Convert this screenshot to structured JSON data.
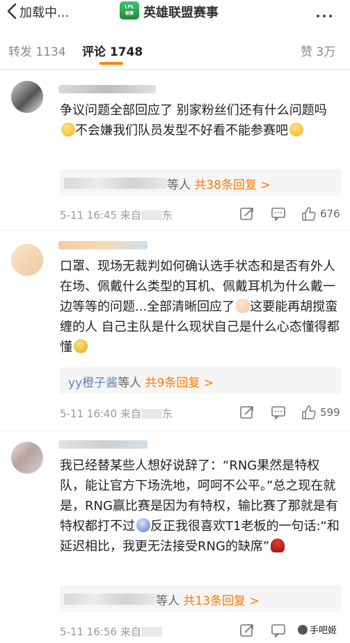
{
  "header": {
    "back_label": "加载中...",
    "logo_text": "LPL",
    "title": "英雄联盟赛事"
  },
  "tabs": [
    {
      "label": "转发 1134"
    },
    {
      "label": "评论 1748"
    },
    {
      "label": "赞 3万"
    }
  ],
  "comments": [
    {
      "text": "争议问题全部回应了 别家粉丝们还有什么问题吗",
      "text_tail": "不会嫌我们队员发型不好看不能参赛吧",
      "reply_suffix": "等人",
      "reply_count": "共38条回复 >",
      "time": "5-11 16:45",
      "source": "来自",
      "source_tail": "东",
      "likes": "676"
    },
    {
      "text": "口罩、现场无裁判如何确认选手状态和是否有外人在场、佩戴什么类型的耳机、佩戴耳机为什么戴一边等等的问题...全部清晰回应了",
      "text_tail": "这要能再胡搅蛮缠的人 自己主队是什么现状自己是什么心态懂得都懂",
      "reply_user": "yy橙子酱",
      "reply_suffix": "等人",
      "reply_count": "共9条回复 >",
      "time": "5-11 16:40",
      "source": "来自",
      "source_tail": "东",
      "likes": "599"
    },
    {
      "text": "我已经替某些人想好说辞了：“RNG果然是特权队，能让官方下场洗地，呵呵不公平。”总之现在就是，RNG赢比赛是因为有特权，输比赛了那就是有特权都打不过",
      "text_tail": "反正我很喜欢T1老板的一句话:“和延迟相比，我更无法接受RNG的缺席”",
      "reply_suffix": "等人",
      "reply_count": "共13条回复 >",
      "time": "5-11 16:56",
      "source": "来自"
    }
  ],
  "watermark": "手吧姬"
}
